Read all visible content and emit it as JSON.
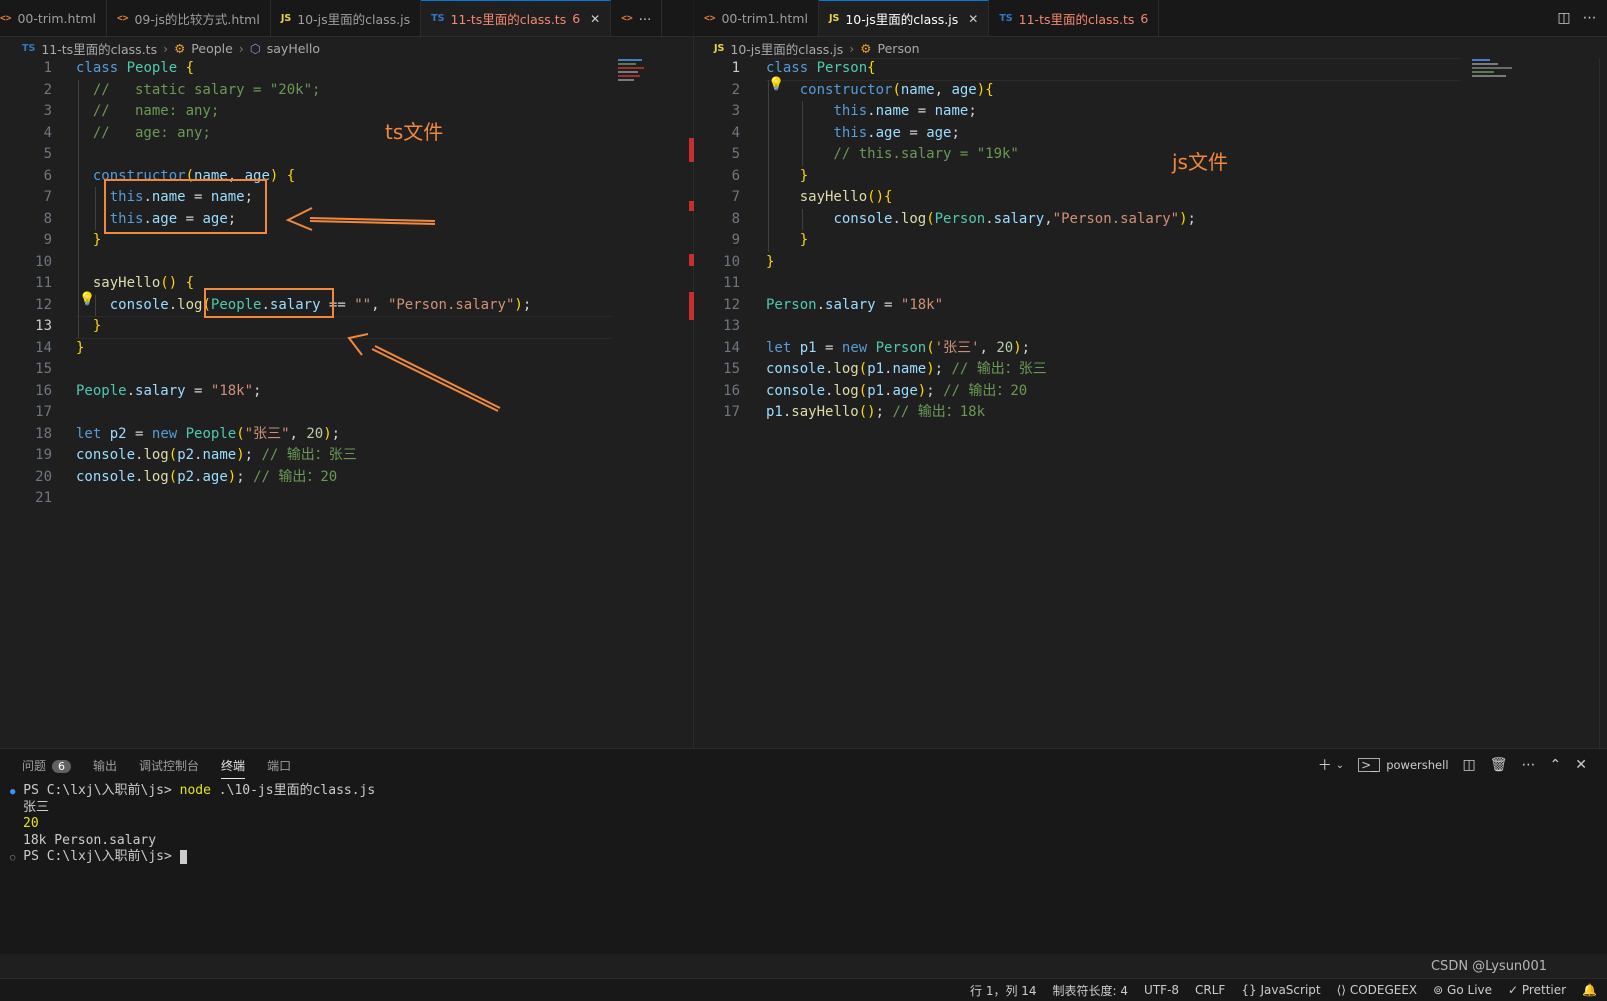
{
  "left_tabs": [
    {
      "icon": "html",
      "label": "00-trim.html",
      "state": "normal"
    },
    {
      "icon": "html",
      "label": "09-js的比较方式.html",
      "state": "normal"
    },
    {
      "icon": "js",
      "label": "10-js里面的class.js",
      "state": "normal"
    },
    {
      "icon": "ts",
      "label": "11-ts里面的class.ts",
      "count": "6",
      "state": "active-error"
    },
    {
      "icon": "html",
      "label": "",
      "state": "overflow"
    }
  ],
  "right_tabs": [
    {
      "icon": "html",
      "label": "00-trim1.html",
      "state": "normal"
    },
    {
      "icon": "js",
      "label": "10-js里面的class.js",
      "state": "active"
    },
    {
      "icon": "ts",
      "label": "11-ts里面的class.ts",
      "count": "6",
      "state": "error"
    }
  ],
  "left_breadcrumb": {
    "file": "11-ts里面的class.ts",
    "class": "People",
    "method": "sayHello"
  },
  "right_breadcrumb": {
    "file": "10-js里面的class.js",
    "class": "Person"
  },
  "left_editor": {
    "line_numbers": [
      "1",
      "2",
      "3",
      "4",
      "5",
      "6",
      "7",
      "8",
      "9",
      "10",
      "11",
      "12",
      "13",
      "14",
      "15",
      "16",
      "17",
      "18",
      "19",
      "20",
      "21"
    ],
    "lines": [
      "class People {",
      "  //   static salary = \"20k\";",
      "  //   name: any;",
      "  //   age: any;",
      "",
      "  constructor(name, age) {",
      "    this.name = name;",
      "    this.age = age;",
      "  }",
      "",
      "  sayHello() {",
      "    console.log(People.salary == \"\", \"Person.salary\");",
      "  }",
      "}",
      "",
      "People.salary = \"18k\";",
      "",
      "let p2 = new People(\"张三\", 20);",
      "console.log(p2.name); // 输出：张三",
      "console.log(p2.age); // 输出：20",
      ""
    ],
    "annotation": "ts文件"
  },
  "right_editor": {
    "line_numbers": [
      "1",
      "2",
      "3",
      "4",
      "5",
      "6",
      "7",
      "8",
      "9",
      "10",
      "11",
      "12",
      "13",
      "14",
      "15",
      "16",
      "17"
    ],
    "lines": [
      "class Person{",
      "    constructor(name, age){",
      "        this.name = name;",
      "        this.age = age;",
      "        // this.salary = \"19k\"",
      "    }",
      "    sayHello(){",
      "        console.log(Person.salary,\"Person.salary\");",
      "    }",
      "}",
      "",
      "Person.salary = \"18k\"",
      "",
      "let p1 = new Person('张三', 20);",
      "console.log(p1.name); // 输出：张三",
      "console.log(p1.age); // 输出：20",
      "p1.sayHello(); // 输出：18k"
    ],
    "annotation": "js文件"
  },
  "panel": {
    "tabs": [
      "问题",
      "输出",
      "调试控制台",
      "终端",
      "端口"
    ],
    "problems_count": "6",
    "active_tab": "终端",
    "shell_label": "powershell"
  },
  "terminal": {
    "lines": [
      {
        "prompt": "PS C:\\lxj\\入职前\\js> ",
        "cmd": "node ",
        "arg": ".\\10-js里面的class.js"
      },
      {
        "text": "张三"
      },
      {
        "text": "20"
      },
      {
        "text": "18k Person.salary"
      },
      {
        "prompt": "PS C:\\lxj\\入职前\\js> ",
        "cmd": "",
        "arg": ""
      }
    ]
  },
  "statusbar": {
    "position": "行 1，列 14",
    "tab_size": "制表符长度: 4",
    "encoding": "UTF-8",
    "eol": "CRLF",
    "language": "JavaScript",
    "codegeex": "CODEGEEX",
    "golive": "Go Live",
    "prettier": "Prettier",
    "watermark": "CSDN @Lysun001"
  },
  "colors": {
    "accent": "#0078d4",
    "annotation": "#f0883e",
    "error": "#f48771"
  }
}
